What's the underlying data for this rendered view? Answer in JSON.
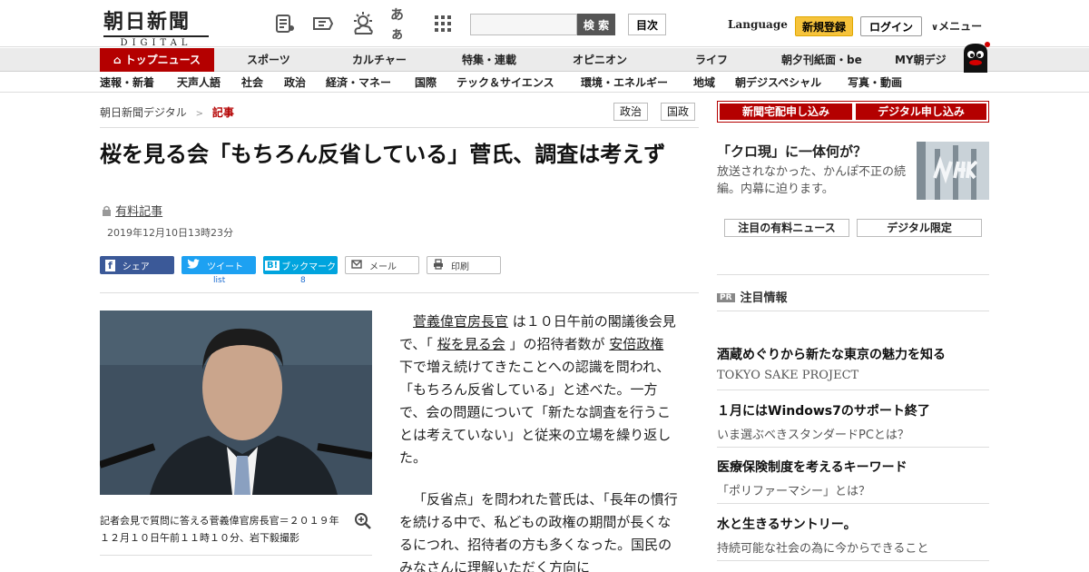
{
  "header": {
    "logo_main": "朝日新聞",
    "logo_sub": "DIGITAL",
    "icon_kana": "あぁ",
    "search_button": "検 索",
    "mokuji_button": "目次",
    "language": "Language",
    "register": "新規登録",
    "login": "ログイン",
    "menu": "メニュー"
  },
  "nav_primary": [
    "トップニュース",
    "スポーツ",
    "カルチャー",
    "特集・連載",
    "オピニオン",
    "ライフ",
    "朝夕刊紙面・be",
    "MY朝デジ"
  ],
  "nav_secondary": [
    "速報・新着",
    "天声人語",
    "社会",
    "政治",
    "経済・マネー",
    "国際",
    "テック＆サイエンス",
    "環境・エネルギー",
    "地域",
    "朝デジスペシャル",
    "写真・動画"
  ],
  "breadcrumb": {
    "home": "朝日新聞デジタル",
    "sep": ">",
    "current": "記事"
  },
  "tags": [
    "政治",
    "国政"
  ],
  "article": {
    "title": "桜を見る会「もちろん反省している」菅氏、調査は考えず",
    "paid_label": "有料記事",
    "date": "2019年12月10日13時23分",
    "share": {
      "facebook": "シェア",
      "twitter": "ツイート",
      "hatena": "ブックマーク",
      "mail": "メール",
      "print": "印刷",
      "twitter_sub": "list",
      "hatena_sub": "8"
    },
    "photo_caption": "記者会見で質問に答える菅義偉官房長官＝２０１９年１２月１０日午前１１時１０分、岩下毅撮影",
    "p1_link1": "菅義偉官房長官",
    "p1_a": "は１０日午前の閣議後会見で、「",
    "p1_link2": "桜を見る会",
    "p1_b": "」の招待者数が",
    "p1_link3": "安倍政権",
    "p1_c": "下で増え続けてきたことへの認識を問われ、「もちろん反省している」と述べた。一方で、会の問題について「新たな調査を行うことは考えていない」と従来の立場を繰り返した。",
    "p2": "「反省点」を問われた菅氏は、「長年の慣行を続ける中で、私どもの政権の期間が長くなるにつれ、招待者の方も多くなった。国民のみなさんに理解いただく方向に"
  },
  "sidebar": {
    "delivery": "新聞宅配申し込み",
    "digital": "デジタル申し込み",
    "promo_title": "「クロ現」に一体何が？",
    "promo_text": "放送されなかった、かんぽ不正の続編。内幕に迫ります。",
    "tab1": "注目の有料ニュース",
    "tab2": "デジタル限定",
    "pr_badge": "PR",
    "pr_title": "注目情報",
    "ads": [
      {
        "title": "酒蔵めぐりから新たな東京の魅力を知る",
        "sub": "TOKYO SAKE PROJECT"
      },
      {
        "title": "１月にはWindows7のサポート終了",
        "sub": "いま選ぶべきスタンダードPCとは？"
      },
      {
        "title": "医療保険制度を考えるキーワード",
        "sub": "「ポリファーマシー」とは？"
      },
      {
        "title": "水と生きるサントリー。",
        "sub": "持続可能な社会の為に今からできること"
      }
    ]
  }
}
